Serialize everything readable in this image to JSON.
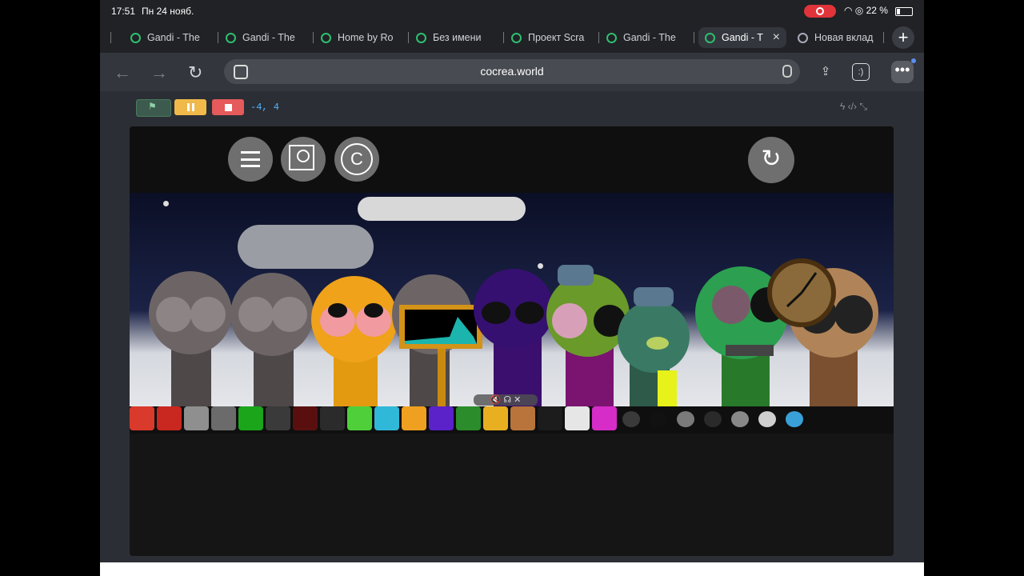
{
  "status_bar": {
    "time": "17:51",
    "date": "Пн 24 нояб.",
    "battery": "22 %"
  },
  "tabs": [
    {
      "label": "Gandi - The"
    },
    {
      "label": "Gandi - The"
    },
    {
      "label": "Home by Ro"
    },
    {
      "label": "Без имени"
    },
    {
      "label": "Проект Scra"
    },
    {
      "label": "Gandi - The"
    },
    {
      "label": "Gandi - T",
      "active": true
    },
    {
      "label": "Новая вклад"
    }
  ],
  "address_bar": {
    "url": "cocrea.world"
  },
  "toolbar": {
    "coords": "-4, 4"
  },
  "tray_colors": [
    "#d93a2b",
    "#c8281f",
    "#8f8f8f",
    "#6b6b6b",
    "#1aa51a",
    "#3a3a3a",
    "#5a0f0f",
    "#2b2b2b",
    "#4fcf3a",
    "#2fb8d8",
    "#f0a020",
    "#5a22c8",
    "#2b8c2b",
    "#e8b020",
    "#b8743a",
    "#1c1c1c",
    "#e6e6e6",
    "#d62cc8"
  ],
  "tray_round_colors": [
    "#3a3a3a",
    "#111111",
    "#7a7a7a",
    "#2a2a2a",
    "#888888",
    "#cfcfcf",
    "#3aa0d8"
  ],
  "colors": {
    "accent": "#2fbf6f",
    "flag": "#3c5a4d",
    "pause": "#f0b94a",
    "stop": "#e55a5a"
  }
}
